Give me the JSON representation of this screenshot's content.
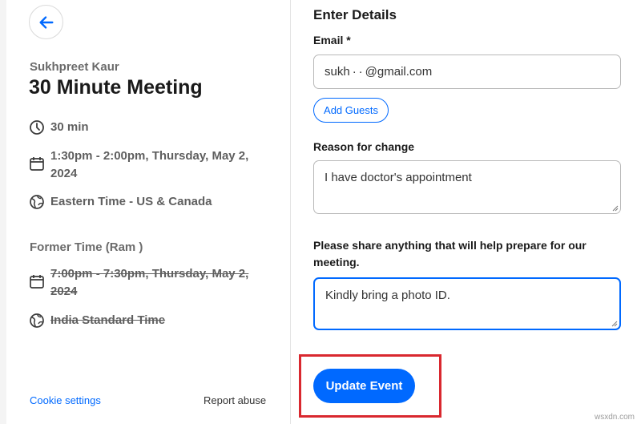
{
  "summary": {
    "host_name": "Sukhpreet Kaur",
    "event_title": "30 Minute Meeting",
    "duration": "30 min",
    "time_range": "1:30pm - 2:00pm, Thursday, May 2, 2024",
    "timezone": "Eastern Time - US & Canada",
    "former_label": "Former Time (Ram )",
    "former_time_range": "7:00pm - 7:30pm, Thursday, May 2, 2024",
    "former_timezone": "India Standard Time",
    "cookie_settings": "Cookie settings",
    "report_abuse": "Report abuse"
  },
  "form": {
    "section_title": "Enter Details",
    "email_label": "Email *",
    "email_value": "sukh · · @gmail.com",
    "add_guests": "Add Guests",
    "reason_label": "Reason for change",
    "reason_value": "I have doctor's appointment",
    "share_label": "Please share anything that will help prepare for our meeting.",
    "share_value": "Kindly bring a photo ID.",
    "update_button": "Update Event"
  },
  "watermark": "wsxdn.com",
  "colors": {
    "accent": "#0069ff",
    "highlight": "#d9282f"
  },
  "icons": {
    "back": "arrow-left-icon",
    "duration": "clock-icon",
    "calendar": "calendar-icon",
    "timezone": "globe-icon"
  }
}
